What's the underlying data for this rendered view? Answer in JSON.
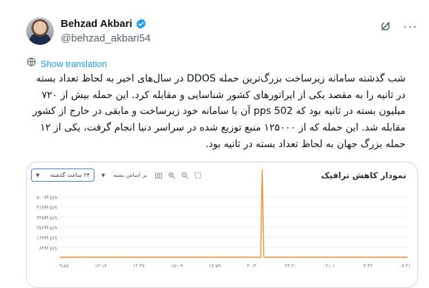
{
  "author": {
    "display_name": "Behzad Akbari",
    "handle": "@behzad_akbari54"
  },
  "translation_label": "Show translation",
  "tweet_text": "شب گذشته سامانه زیرساخت بزرگ‌ترین حمله DDOS در سال‌های اخیر به لحاظ تعداد بسته در ثانیه را به مقصد یکی از اپراتورهای کشور شناسایی و مقابله کرد. این حمله بیش از ۷۲۰ میلیون بسته در ثانیه بود که 502 pps آن با سامانه خود زیرساخت و مابقی در خارج از کشور مقابله شد. این حمله که از ۱۲۵۰۰۰ منبع توزیع شده در سراسر دنیا انجام گرفت، یکی از ۱۲ حمله بزرگ جهان به لحاظ تعداد بسته در ثانیه بود.",
  "card": {
    "title": "نمودار کاهش ترافیک",
    "period_select": "۲۴ ساعت گذشته",
    "basis_select": "بر اساس بسته"
  },
  "colors": {
    "accent": "#1d9bf0",
    "series": "#f28c28",
    "select_border": "#3f7ad6"
  },
  "icons": {
    "verified": "verified-badge-icon",
    "grok": "grok-icon",
    "more": "more-dots-icon",
    "translate": "translate-icon"
  },
  "chart_data": {
    "type": "line",
    "title": "نمودار کاهش ترافیک",
    "xlabel": "",
    "ylabel": "",
    "y_tick_labels": [
      "۵۰۰M p/s",
      "۴۱۷M p/s",
      "۳۳۵M p/s",
      "۲۵۲M p/s",
      "۱۶۷M p/s",
      "۸۴M p/s"
    ],
    "x_tick_labels": [
      "۰۹:۵۸",
      "۱۲:۱۷",
      "۱۲:۴۷",
      "۱۵:۰۹",
      "۱۷:۵۹",
      "۲۰:۴۰",
      "۲۳:۲۰",
      "۰۲:۰۱",
      "۰۴:۴۲",
      "۰۷:۲۱"
    ],
    "ylim": [
      0,
      500
    ],
    "grid": true,
    "legend": "none",
    "series": [
      {
        "values": [
          3,
          4,
          3,
          5,
          4,
          3,
          4,
          6,
          3,
          4,
          5,
          3,
          4,
          3,
          5,
          4,
          6,
          4,
          3,
          4,
          5,
          3,
          4,
          4,
          3,
          5,
          4,
          3,
          6,
          4,
          3,
          4,
          5,
          4,
          3,
          4,
          5,
          3,
          4,
          5,
          4,
          3,
          4,
          4,
          3,
          5,
          4,
          3,
          4,
          5,
          4,
          3,
          4,
          3,
          5,
          4,
          3,
          4,
          4,
          3,
          5,
          4,
          3,
          4,
          3,
          5,
          4,
          3,
          4,
          4,
          3,
          5,
          4,
          3,
          4,
          5,
          4,
          3,
          4,
          4,
          3,
          5,
          4,
          3,
          4,
          4,
          3,
          5,
          4,
          3,
          4,
          3,
          4,
          5,
          3,
          4,
          4,
          3,
          5,
          4,
          3,
          4,
          5,
          4,
          3,
          4,
          4,
          3,
          5,
          4,
          3,
          4,
          4,
          3,
          5,
          4,
          3,
          4,
          5,
          4,
          3,
          4,
          4,
          3,
          5,
          4,
          3,
          4,
          720,
          6,
          4,
          3,
          4,
          5,
          3,
          4,
          4,
          3,
          5,
          4,
          3,
          4,
          4,
          3,
          5,
          4,
          3,
          4,
          5,
          4,
          3,
          4,
          4,
          3,
          5,
          4,
          3,
          4,
          4,
          3,
          5,
          4,
          3,
          4,
          5,
          4,
          3,
          4,
          4,
          3,
          5,
          4,
          3,
          4,
          4,
          3,
          5,
          4,
          3,
          4,
          5,
          4,
          3,
          4,
          4,
          3,
          5,
          4,
          3,
          4,
          4,
          3,
          5,
          4,
          3,
          4,
          5,
          4,
          3,
          4,
          4,
          3,
          5,
          4,
          3,
          4,
          4,
          3,
          5,
          4,
          3,
          4,
          5,
          4,
          3,
          4,
          4,
          3,
          5,
          4,
          3
        ]
      }
    ]
  }
}
